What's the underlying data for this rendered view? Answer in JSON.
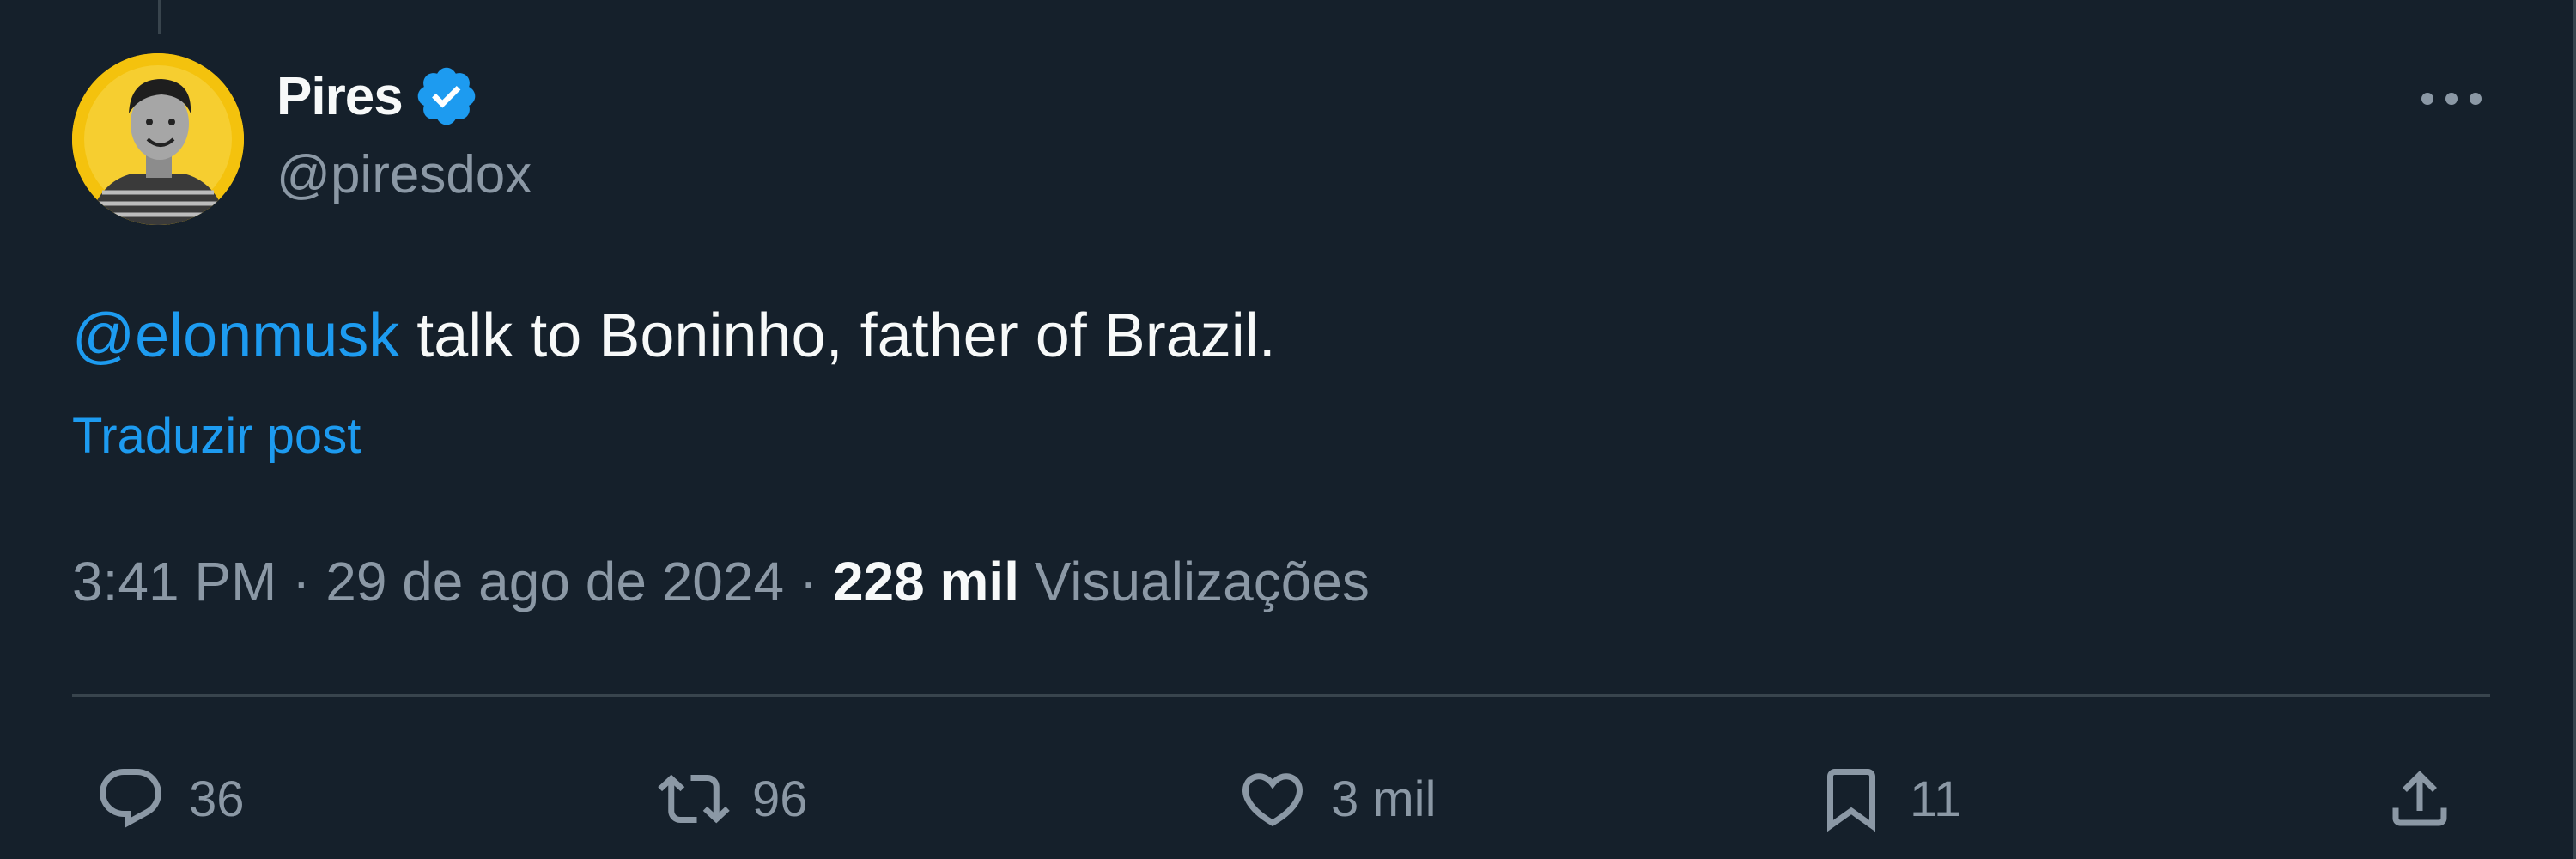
{
  "author": {
    "name": "Pires",
    "handle": "@piresdox",
    "verified": true
  },
  "post": {
    "mention": "@elonmusk",
    "text": " talk to Boninho, father of Brazil.",
    "translate_label": "Traduzir post"
  },
  "meta": {
    "time": "3:41 PM",
    "separator": " · ",
    "date": "29 de ago de 2024",
    "views_count": "228 mil",
    "views_label": "Visualizações"
  },
  "actions": {
    "replies": "36",
    "reposts": "96",
    "likes": "3 mil",
    "bookmarks": "11"
  },
  "colors": {
    "background": "#15202b",
    "accent": "#1d9bf0",
    "secondary_text": "#8b98a5",
    "primary_text": "#f7f9f9",
    "divider": "#38444d",
    "avatar_background": "#f4c20d"
  },
  "icons": {
    "more": "more-horizontal-icon",
    "verified": "verified-badge-icon",
    "reply": "reply-icon",
    "repost": "repost-icon",
    "like": "heart-icon",
    "bookmark": "bookmark-icon",
    "share": "share-icon"
  }
}
